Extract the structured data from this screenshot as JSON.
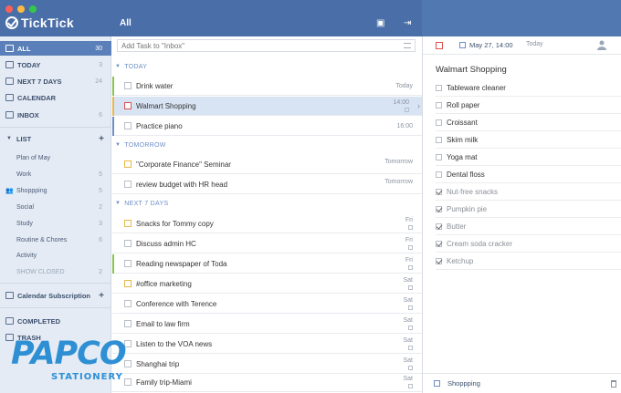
{
  "app": {
    "name": "TickTick",
    "current_list": "All"
  },
  "colors": {
    "titlebar": "#4a6ea8",
    "sidebar_active": "#5b7fb9",
    "accent": "#6d8fc7",
    "watermark": "#2e8fd4"
  },
  "sidebar": {
    "smart": [
      {
        "label": "ALL",
        "count": "30",
        "icon": "inbox-tray-icon"
      },
      {
        "label": "TODAY",
        "count": "3",
        "icon": "calendar-day-icon"
      },
      {
        "label": "NEXT 7 DAYS",
        "count": "24",
        "icon": "calendar-week-icon"
      },
      {
        "label": "CALENDAR",
        "count": "",
        "icon": "calendar-icon"
      },
      {
        "label": "INBOX",
        "count": "6",
        "icon": "inbox-icon"
      }
    ],
    "list_header": "LIST",
    "lists": [
      {
        "label": "Plan of May",
        "count": ""
      },
      {
        "label": "Work",
        "count": "5"
      },
      {
        "label": "Shoppping",
        "count": "5"
      },
      {
        "label": "Social",
        "count": "2"
      },
      {
        "label": "Study",
        "count": "3"
      },
      {
        "label": "Routine & Chores",
        "count": "6"
      },
      {
        "label": "Activity",
        "count": ""
      },
      {
        "label": "SHOW CLOSED",
        "count": "2"
      }
    ],
    "subscription": "Calendar Subscription",
    "completed": "COMPLETED",
    "trash": "TRASH"
  },
  "watermark": {
    "brand": "PAPCO",
    "sub": "STATIONERY"
  },
  "tasks": {
    "add_placeholder": "Add Task to \"Inbox\"",
    "sections": [
      {
        "name": "TODAY"
      },
      {
        "name": "TOMORROW"
      },
      {
        "name": "NEXT 7 DAYS"
      }
    ],
    "today": [
      {
        "title": "Drink water",
        "date": "Today"
      },
      {
        "title": "Walmart Shopping",
        "date": "14:00"
      },
      {
        "title": "Practice piano",
        "date": "16:00"
      }
    ],
    "tomorrow": [
      {
        "title": "\"Corporate Finance\" Seminar",
        "date": "Tomorrow"
      },
      {
        "title": "review budget with HR head",
        "date": "Tomorrow"
      }
    ],
    "next7": [
      {
        "title": "Snacks for Tommy copy",
        "date": "Fri"
      },
      {
        "title": "Discuss admin HC",
        "date": "Fri"
      },
      {
        "title": "Reading newspaper of Toda",
        "date": "Fri"
      },
      {
        "title": "#office marketing",
        "date": "Sat"
      },
      {
        "title": "Conference with Terence",
        "date": "Sat"
      },
      {
        "title": "Email to law firm",
        "date": "Sat"
      },
      {
        "title": "Listen to the VOA news",
        "date": "Sat"
      },
      {
        "title": "Shanghai trip",
        "date": "Sat"
      },
      {
        "title": "Family trip-Miami",
        "date": "Sat"
      }
    ]
  },
  "detail": {
    "date": "May 27, 14:00",
    "repeat": "Today",
    "title": "Walmart Shopping",
    "subtasks": [
      {
        "text": "Tableware cleaner",
        "done": false
      },
      {
        "text": "Roll paper",
        "done": false
      },
      {
        "text": "Croissant",
        "done": false
      },
      {
        "text": "Skim milk",
        "done": false
      },
      {
        "text": "Yoga mat",
        "done": false
      },
      {
        "text": "Dental floss",
        "done": false
      },
      {
        "text": "Nut-free snacks",
        "done": true
      },
      {
        "text": "Pumpkin pie",
        "done": true
      },
      {
        "text": "Butter",
        "done": true
      },
      {
        "text": "Cream soda cracker",
        "done": true
      },
      {
        "text": "Ketchup",
        "done": true
      }
    ],
    "list_name": "Shoppping"
  }
}
